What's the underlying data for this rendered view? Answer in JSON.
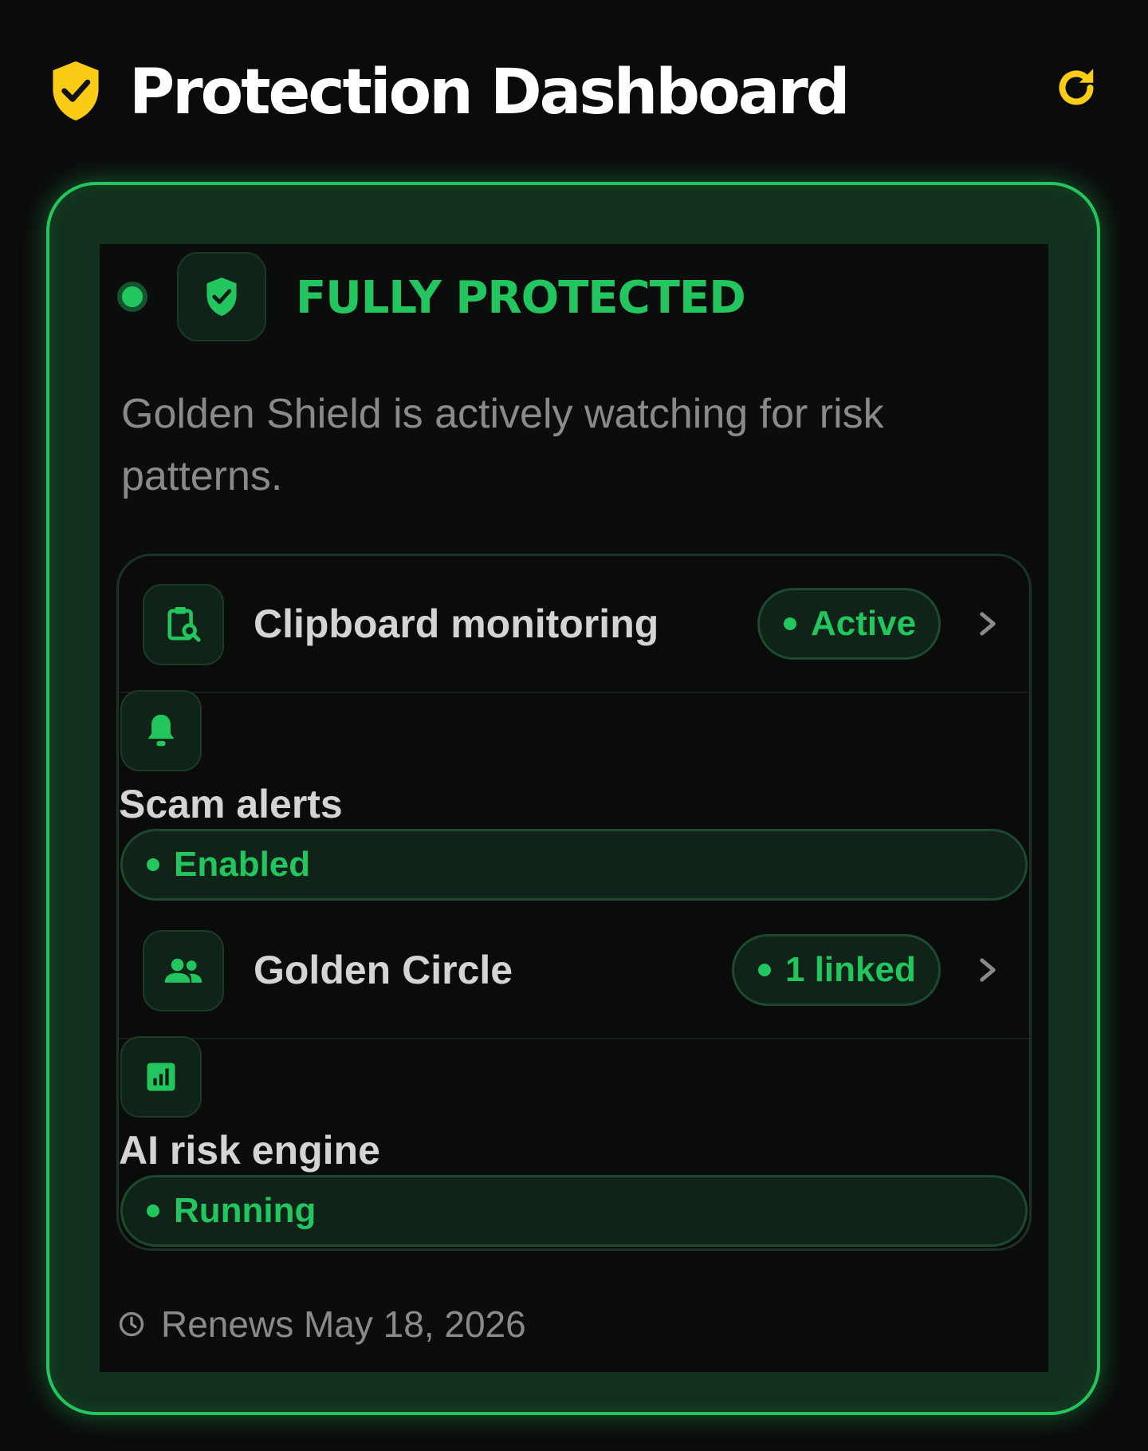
{
  "header": {
    "title": "Protection Dashboard",
    "shield_icon": "shield-check-icon",
    "refresh_icon": "refresh-icon",
    "accent_color": "#facc15"
  },
  "status": {
    "title": "FULLY PROTECTED",
    "subtitle": "Golden Shield is actively watching for risk patterns.",
    "color": "#22c55e"
  },
  "features": [
    {
      "label": "Clipboard monitoring",
      "status": "Active",
      "icon": "clipboard-search-icon"
    },
    {
      "label": "Scam alerts",
      "status": "Enabled",
      "icon": "bell-icon"
    },
    {
      "label": "Golden Circle",
      "status": "1 linked",
      "icon": "people-icon"
    },
    {
      "label": "AI risk engine",
      "status": "Running",
      "icon": "analytics-icon"
    }
  ],
  "footer": {
    "renewal": "Renews May 18, 2026",
    "icon": "clock-icon"
  }
}
